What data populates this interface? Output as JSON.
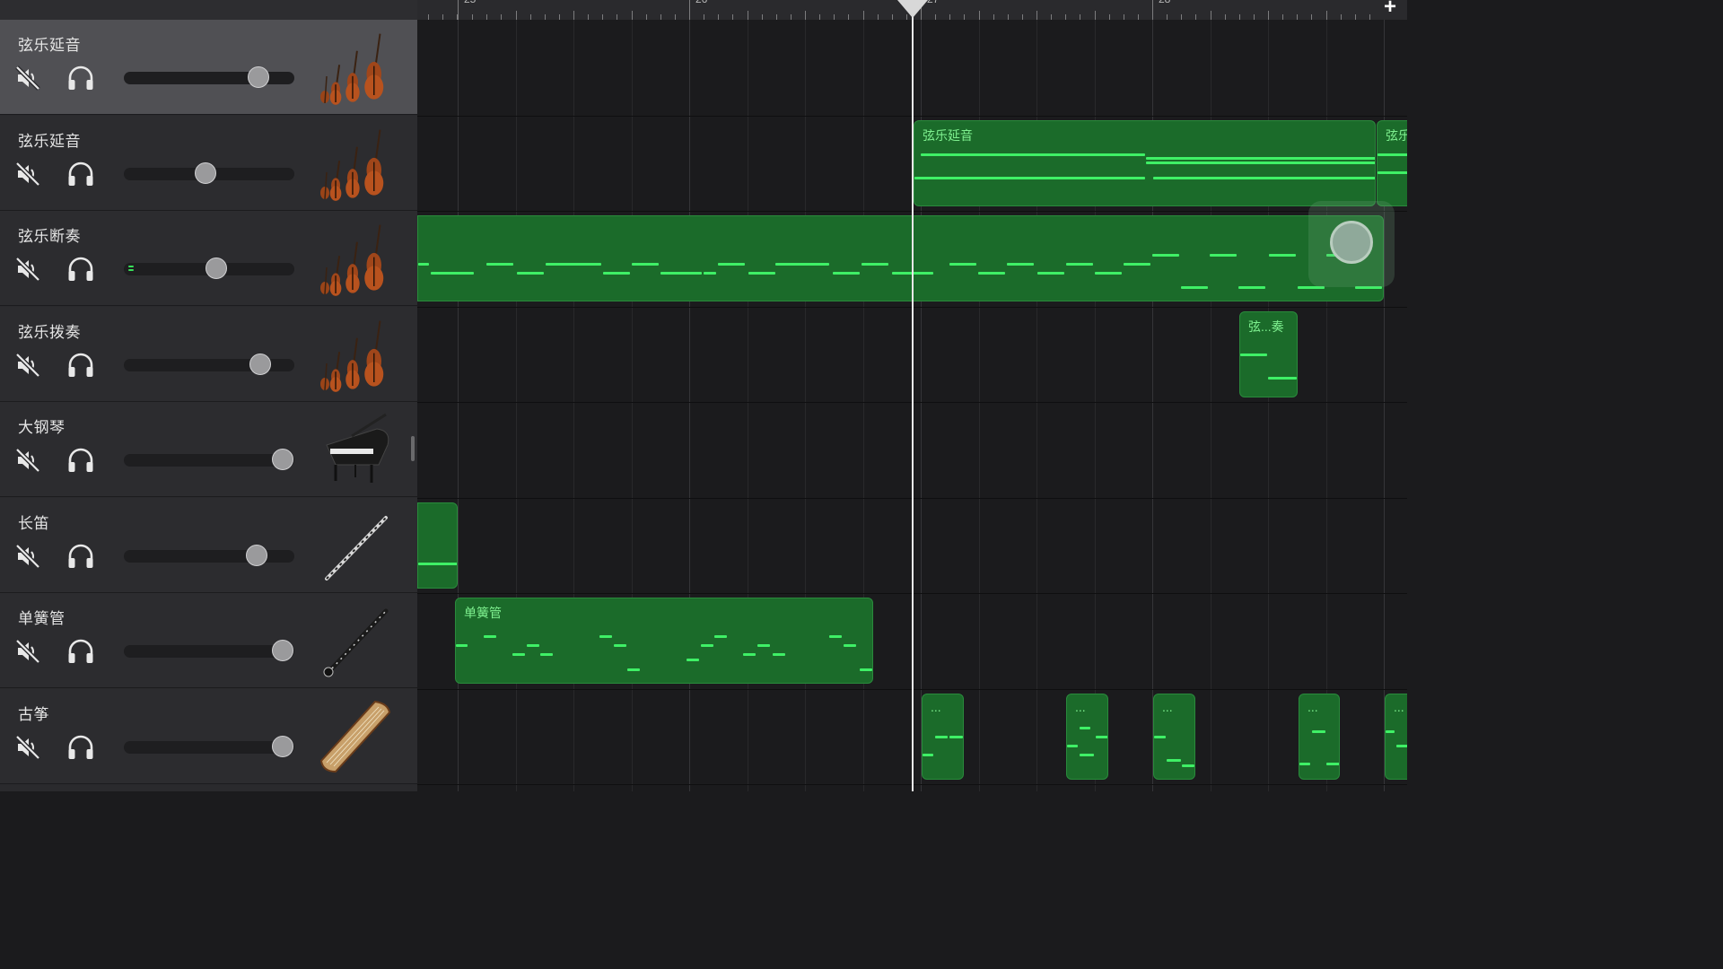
{
  "ruler": {
    "bars": [
      "25",
      "26",
      "27",
      "28"
    ],
    "add_label": "+"
  },
  "tracks": [
    {
      "name": "弦乐延音",
      "instrument": "strings",
      "volume": 0.79,
      "selected": true
    },
    {
      "name": "弦乐延音",
      "instrument": "strings",
      "volume": 0.48,
      "selected": false
    },
    {
      "name": "弦乐断奏",
      "instrument": "strings",
      "volume": 0.54,
      "selected": false,
      "level_meter": true
    },
    {
      "name": "弦乐拨奏",
      "instrument": "strings",
      "volume": 0.8,
      "selected": false
    },
    {
      "name": "大钢琴",
      "instrument": "grand-piano",
      "volume": 0.93,
      "selected": false
    },
    {
      "name": "长笛",
      "instrument": "flute",
      "volume": 0.78,
      "selected": false
    },
    {
      "name": "单簧管",
      "instrument": "clarinet",
      "volume": 0.93,
      "selected": false
    },
    {
      "name": "古筝",
      "instrument": "guzheng",
      "volume": 0.93,
      "selected": false
    }
  ],
  "regions": {
    "strings_sustain_a": "弦乐延音",
    "strings_sustain_b": "弦乐",
    "pizzicato": "弦...奏",
    "clarinet": "单簧管",
    "guzheng": [
      "...",
      "...",
      "...",
      "...",
      "..."
    ]
  },
  "icons": {
    "mute": "speaker-mute-icon",
    "solo": "headphones-icon",
    "playhead": "playhead-icon",
    "add": "plus-icon"
  },
  "colors": {
    "region_fill": "#1b6b2a",
    "note": "#3ff066",
    "region_label": "#7ef08f",
    "selected_track": "#505054"
  }
}
